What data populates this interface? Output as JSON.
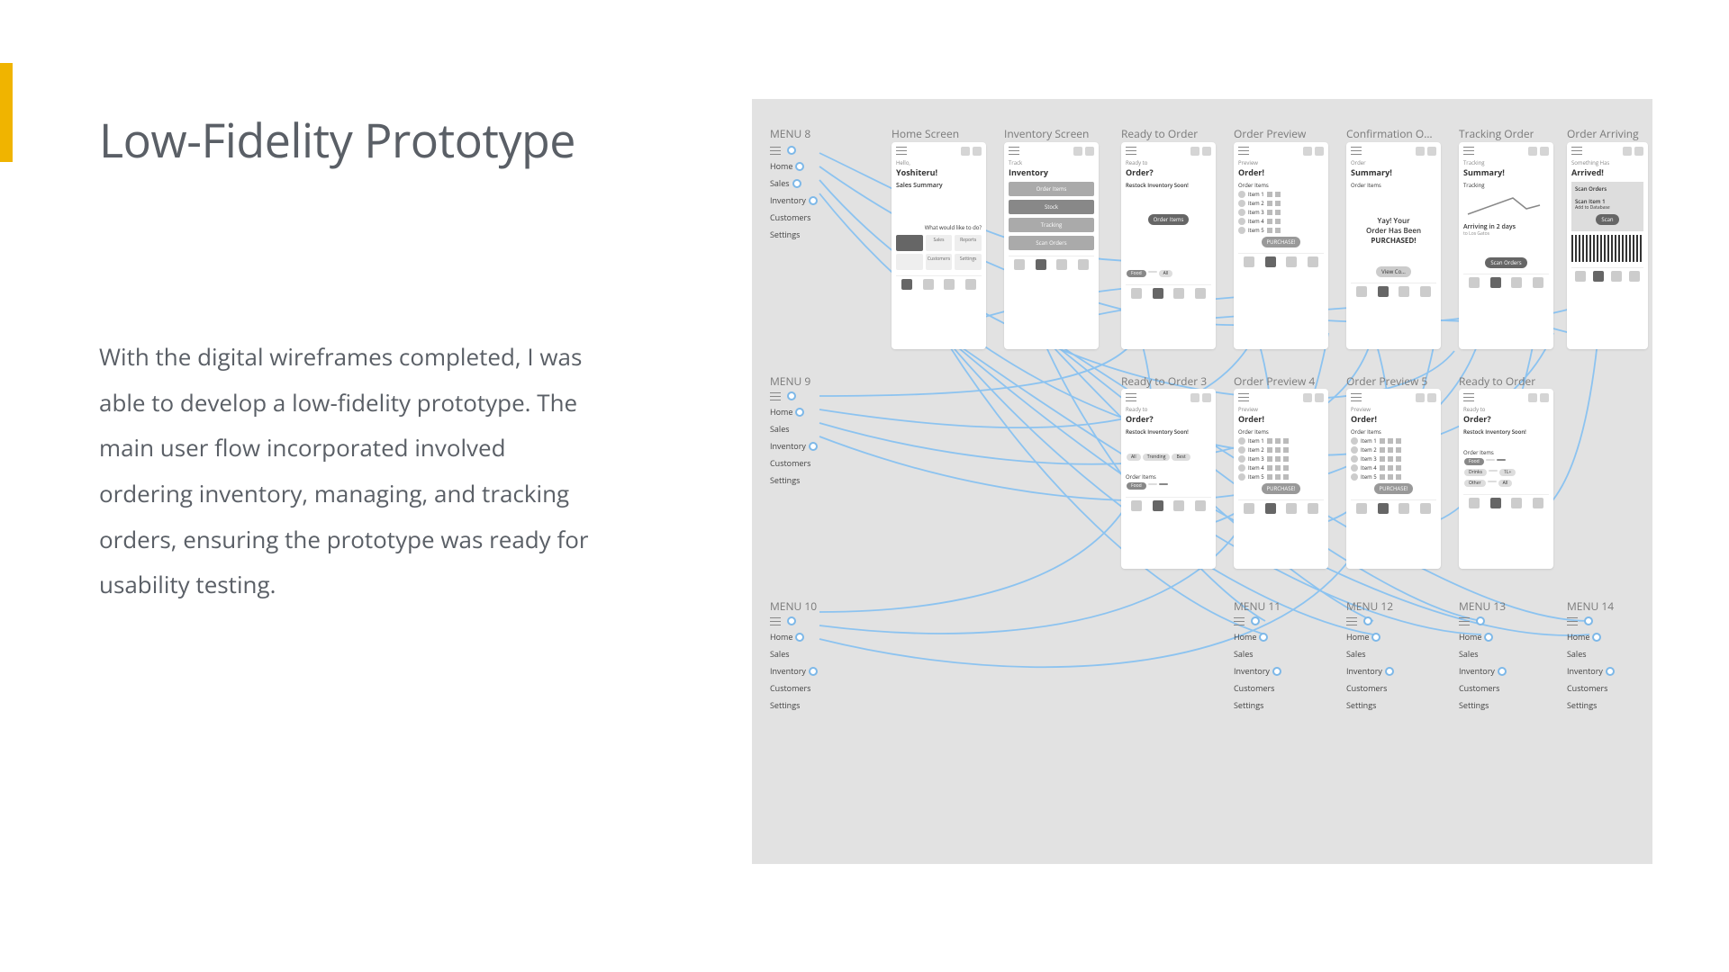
{
  "title": "Low-Fidelity Prototype",
  "body": "With the digital wireframes completed, I was able to develop a low-fidelity prototype. The main user flow incorporated involved ordering inventory, managing, and tracking orders, ensuring the prototype was ready for usability testing.",
  "prototype": {
    "row1_frames": [
      "Home Screen",
      "Inventory Screen",
      "Ready to Order",
      "Order Preview",
      "Confirmation O…",
      "Tracking Order",
      "Order Arriving"
    ],
    "row2_frames": [
      "Ready to Order 3",
      "Order Preview 4",
      "Order Preview 5",
      "Ready to Order"
    ],
    "menus": {
      "m8": "MENU 8",
      "m9": "MENU 9",
      "m10": "MENU 10",
      "m11": "MENU 11",
      "m12": "MENU 12",
      "m13": "MENU 13",
      "m14": "MENU 14"
    },
    "menu_items": [
      "Home",
      "Sales",
      "Inventory",
      "Customers",
      "Settings"
    ],
    "screens": {
      "home": {
        "greet_sm": "Hello,",
        "greet": "Yoshiteru!",
        "section": "Sales Summary",
        "prompt_sm": "What would like to do?"
      },
      "inventory": {
        "sm": "Track",
        "title": "Inventory",
        "btn1": "Order Items",
        "btn2": "Stock",
        "btn3": "Tracking",
        "btn4": "Scan Orders"
      },
      "ready": {
        "sm": "Ready to",
        "title": "Order?",
        "sub": "Restock Inventory Soon!",
        "cta": "Order Items",
        "chips": [
          "Food",
          "All"
        ]
      },
      "preview": {
        "sm": "Preview",
        "title": "Order!",
        "sub": "Order Items",
        "rows": [
          "Item 1",
          "Item 2",
          "Item 3",
          "Item 4",
          "Item 5"
        ],
        "purchase": "PURCHASE!"
      },
      "confirm": {
        "sm": "Order",
        "title": "Summary!",
        "sub": "Order Items",
        "msg1": "Yay! Your",
        "msg2": "Order Has Been",
        "msg3": "PURCHASED!",
        "view": "View Co…"
      },
      "tracking": {
        "sm": "Tracking",
        "title": "Summary!",
        "sub": "Tracking",
        "eta": "Arriving in 2 days",
        "city": "to Los Gatos",
        "cta": "Scan Orders"
      },
      "arriving": {
        "sm": "Something Has",
        "title": "Arrived!",
        "scan": "Scan Orders",
        "item": "Scan Item 1",
        "hint": "Add to Database",
        "btn": "Scan"
      },
      "ready2": {
        "sm": "Ready to",
        "title": "Order?",
        "sub": "Restock Inventory Soon!",
        "cta": "Order Items",
        "chips": [
          "Food",
          "Drinks",
          "Other"
        ],
        "chipsel": [
          "All",
          "1L+"
        ]
      }
    }
  }
}
